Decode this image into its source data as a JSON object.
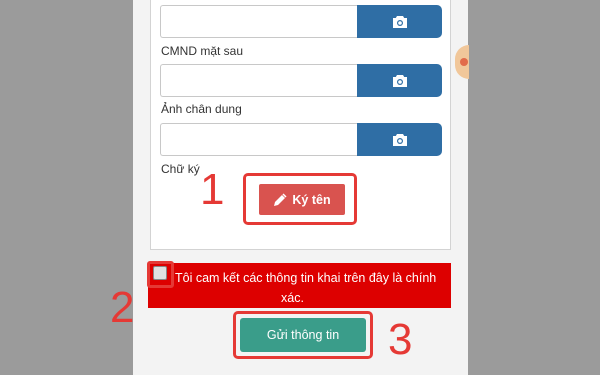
{
  "form": {
    "fields": [
      {
        "label": "",
        "value": ""
      },
      {
        "label": "CMND mặt sau",
        "value": ""
      },
      {
        "label": "Ảnh chân dung",
        "value": ""
      }
    ],
    "signature_label": "Chữ ký",
    "sign_button": "Ký tên",
    "commit_text_line1": "Tôi cam kết các thông tin khai trên đây là chính",
    "commit_text_line2": "xác.",
    "commit_checked": false,
    "submit_button": "Gửi thông tin"
  },
  "annotations": {
    "step1": "1",
    "step2": "2",
    "step3": "3"
  },
  "colors": {
    "camera_button": "#2f6ea5",
    "sign_button": "#d9534f",
    "commit_bar": "#dd0000",
    "submit_button": "#3a9d8a",
    "highlight": "#e53935"
  }
}
